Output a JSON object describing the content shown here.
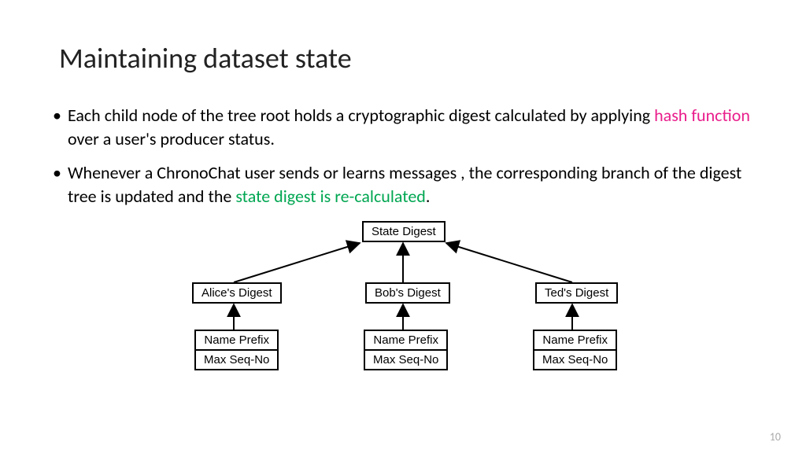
{
  "title": "Maintaining dataset state",
  "bullets": {
    "b1": {
      "pre": "Each child node of the tree root holds a cryptographic digest calculated by applying ",
      "highlight": "hash function",
      "post": " over a user's producer status."
    },
    "b2": {
      "pre": "Whenever a ChronoChat user sends or learns messages , the corresponding branch of the digest tree is updated and the ",
      "highlight": "state digest is re-calculated",
      "post": "."
    }
  },
  "diagram": {
    "root": "State Digest",
    "children": [
      {
        "label": "Alice's Digest",
        "name_prefix": "Name Prefix",
        "seq": "Max Seq-No"
      },
      {
        "label": "Bob's Digest",
        "name_prefix": "Name Prefix",
        "seq": "Max Seq-No"
      },
      {
        "label": "Ted's Digest",
        "name_prefix": "Name Prefix",
        "seq": "Max Seq-No"
      }
    ]
  },
  "page_number": "10"
}
